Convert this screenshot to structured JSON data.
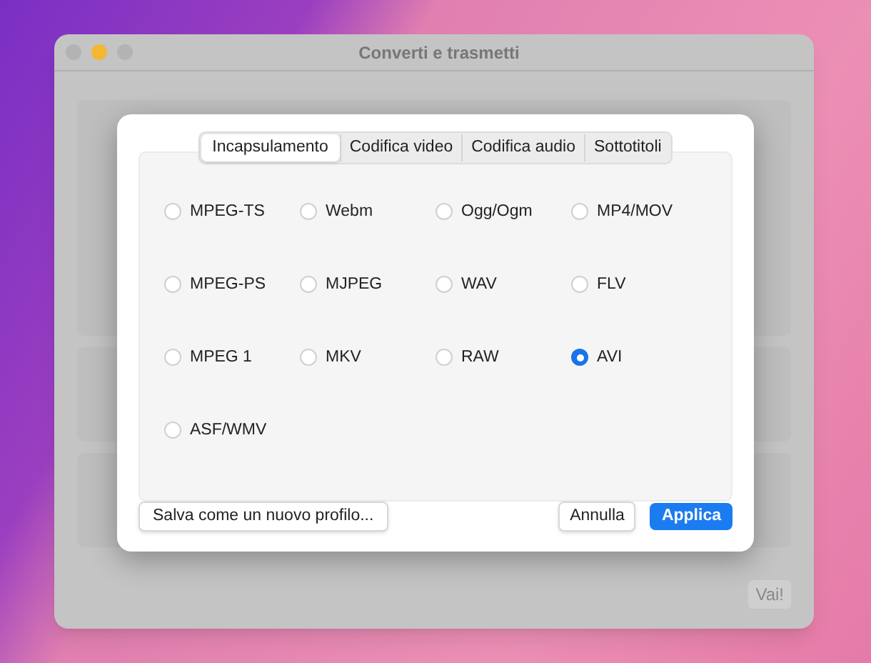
{
  "window": {
    "title": "Converti e trasmetti"
  },
  "background": {
    "go_button": "Vai!"
  },
  "dialog": {
    "tabs": [
      {
        "label": "Incapsulamento",
        "selected": true
      },
      {
        "label": "Codifica video",
        "selected": false
      },
      {
        "label": "Codifica audio",
        "selected": false
      },
      {
        "label": "Sottotitoli",
        "selected": false
      }
    ],
    "options": [
      {
        "label": "MPEG-TS",
        "selected": false
      },
      {
        "label": "Webm",
        "selected": false
      },
      {
        "label": "Ogg/Ogm",
        "selected": false
      },
      {
        "label": "MP4/MOV",
        "selected": false
      },
      {
        "label": "MPEG-PS",
        "selected": false
      },
      {
        "label": "MJPEG",
        "selected": false
      },
      {
        "label": "WAV",
        "selected": false
      },
      {
        "label": "FLV",
        "selected": false
      },
      {
        "label": "MPEG 1",
        "selected": false
      },
      {
        "label": "MKV",
        "selected": false
      },
      {
        "label": "RAW",
        "selected": false
      },
      {
        "label": "AVI",
        "selected": true
      },
      {
        "label": "ASF/WMV",
        "selected": false
      }
    ],
    "save_profile_button": "Salva come un nuovo profilo...",
    "cancel_button": "Annulla",
    "apply_button": "Applica"
  }
}
